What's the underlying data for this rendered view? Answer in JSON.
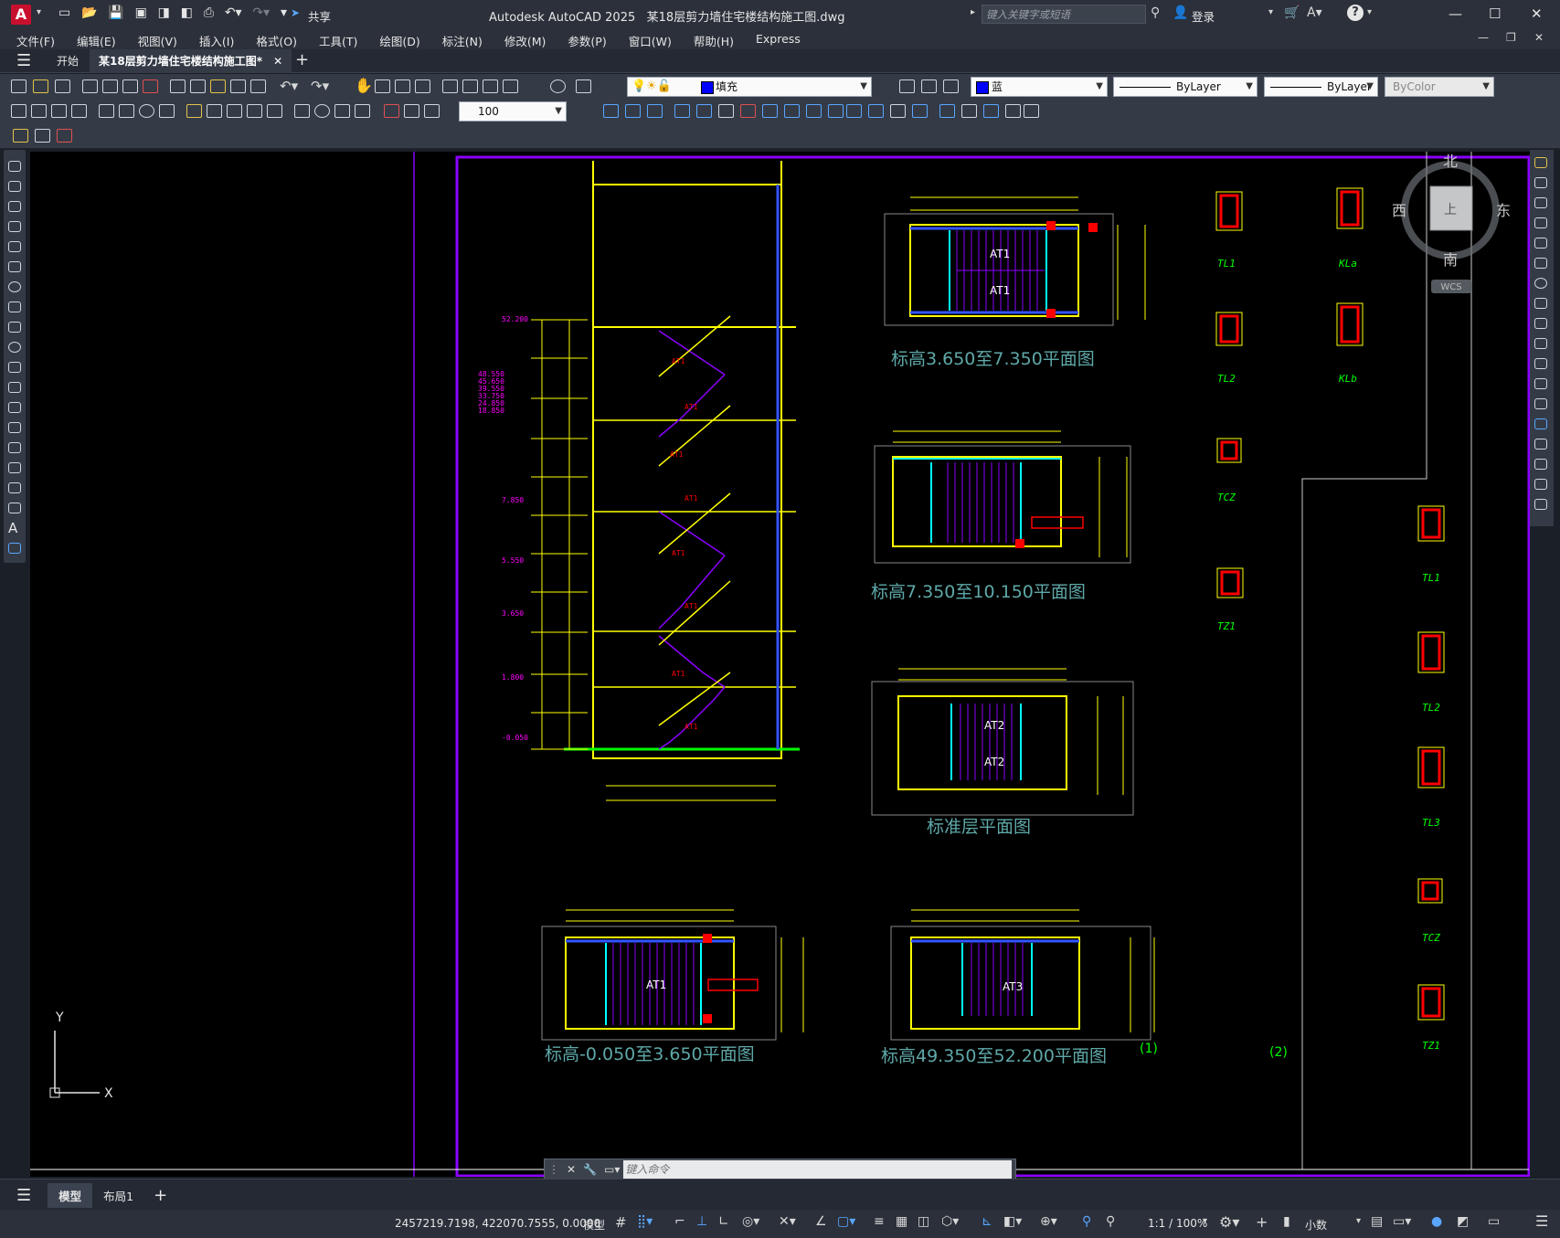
{
  "app": {
    "logo": "A",
    "title": "Autodesk AutoCAD 2025",
    "file": "某18层剪力墙住宅楼结构施工图.dwg",
    "share": "共享",
    "search_placeholder": "键入关键字或短语",
    "login": "登录"
  },
  "menu": [
    "文件(F)",
    "编辑(E)",
    "视图(V)",
    "插入(I)",
    "格式(O)",
    "工具(T)",
    "绘图(D)",
    "标注(N)",
    "修改(M)",
    "参数(P)",
    "窗口(W)",
    "帮助(H)",
    "Express"
  ],
  "tabs": {
    "start": "开始",
    "doc": "某18层剪力墙住宅楼结构施工图*"
  },
  "toolbar": {
    "layer": "填充",
    "color": "蓝",
    "linetype": "ByLayer",
    "lineweight": "ByLayer",
    "plotstyle": "ByColor",
    "scale": "100"
  },
  "viewcube": {
    "north": "北",
    "south": "南",
    "west": "西",
    "east": "东",
    "face": "上",
    "wcs": "WCS"
  },
  "ucs": {
    "x": "X",
    "y": "Y"
  },
  "command": {
    "placeholder": "键入命令"
  },
  "layout_tabs": {
    "model": "模型",
    "layout1": "布局1"
  },
  "status": {
    "coords": "2457219.7198, 422070.7555, 0.0000",
    "mode": "模型",
    "scale": "1:1 / 100%",
    "units": "小数"
  },
  "drawing": {
    "plan_titles": [
      "标高3.650至7.350平面图",
      "标高7.350至10.150平面图",
      "标准层平面图",
      "标高-0.050至3.650平面图",
      "标高49.350至52.200平面图"
    ],
    "stair_labels": {
      "at1": "AT1",
      "at2": "AT2",
      "at3": "AT3"
    },
    "detail_labels_a": [
      "TL1",
      "TL2",
      "TCZ",
      "TZ1"
    ],
    "detail_labels_b": [
      "KLa",
      "KLb"
    ],
    "detail_labels_c": [
      "TL1",
      "TL2",
      "TL3",
      "TCZ",
      "TZ1"
    ],
    "notes": [
      "(1)",
      "(2)"
    ],
    "elevations": [
      "52.200",
      "7.850",
      "5.550",
      "3.650",
      "1.800",
      "-0.050"
    ]
  },
  "colors": {
    "accent": "#8b00ff",
    "cyan": "#00ffff",
    "yellow": "#ffff00",
    "green": "#00ff00",
    "red": "#ff0000",
    "magenta": "#ff00ff",
    "title_text": "#5fa8a8"
  }
}
